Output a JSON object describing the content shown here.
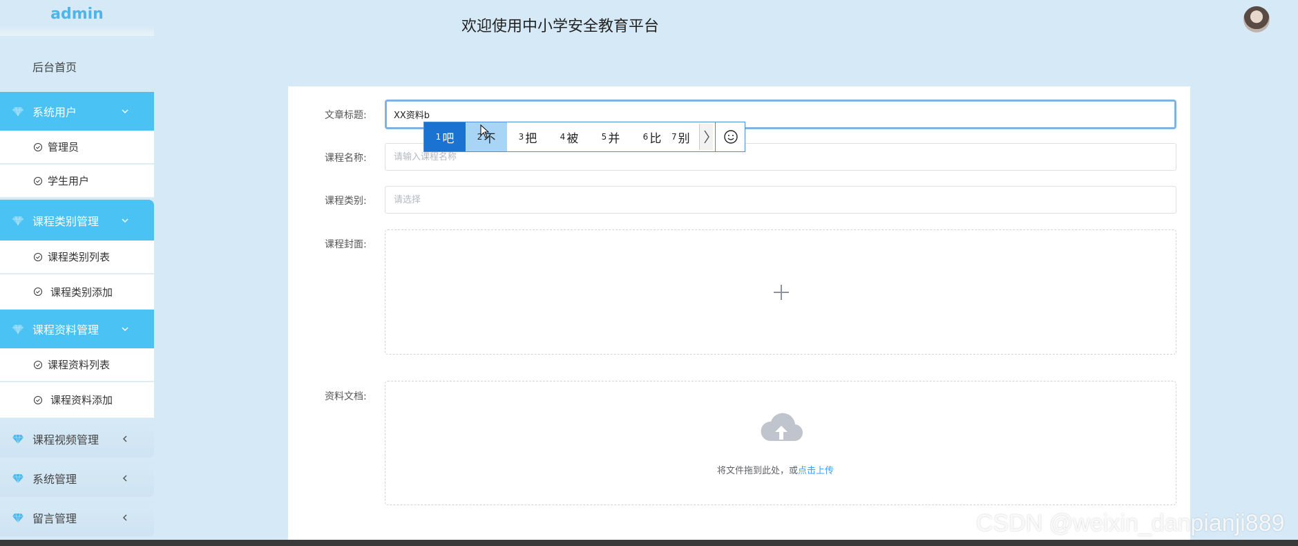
{
  "sidebar": {
    "brand": "admin",
    "home": "后台首页",
    "groups": [
      {
        "label": "系统用户",
        "items": [
          "管理员",
          "学生用户"
        ]
      },
      {
        "label": "课程类别管理",
        "items": [
          "课程类别列表",
          "课程类别添加"
        ]
      },
      {
        "label": "课程资料管理",
        "items": [
          "课程资料列表",
          "课程资料添加"
        ]
      },
      {
        "label": "课程视频管理"
      },
      {
        "label": "系统管理"
      },
      {
        "label": "留言管理"
      }
    ]
  },
  "header": {
    "title": "欢迎使用中小学安全教育平台"
  },
  "form": {
    "title_label": "文章标题:",
    "title_value": "XX资料b",
    "course_name_label": "课程名称:",
    "course_name_placeholder": "请输入课程名称",
    "category_label": "课程类别:",
    "category_placeholder": "请选择",
    "cover_label": "课程封面:",
    "document_label": "资料文档:",
    "drop_text": "将文件拖到此处，或",
    "drop_link": "点击上传"
  },
  "ime": {
    "candidates": [
      {
        "num": "1",
        "char": "吧"
      },
      {
        "num": "2",
        "char": "不"
      },
      {
        "num": "3",
        "char": "把"
      },
      {
        "num": "4",
        "char": "被"
      },
      {
        "num": "5",
        "char": "并"
      },
      {
        "num": "6",
        "char": "比"
      },
      {
        "num": "7",
        "char": "别"
      }
    ]
  },
  "watermark": "CSDN @weixin_danpianji889",
  "colors": {
    "accent": "#4ac2f4",
    "background": "#d6e9f6",
    "link": "#409eff"
  }
}
